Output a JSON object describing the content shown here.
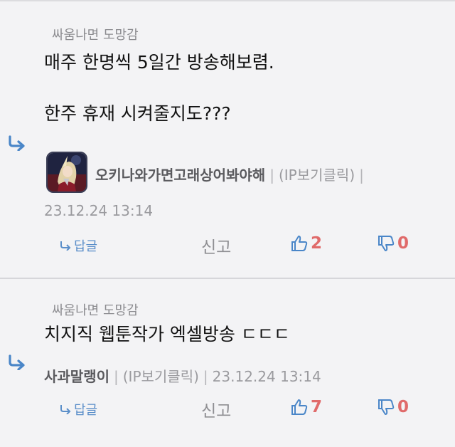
{
  "comments": [
    {
      "parent_name": "싸움나면 도망감",
      "text": "매주 한명씩 5일간 방송해보렴.\n\n한주 휴재 시켜줄지도???",
      "author": "오키나와가면고래상어봐야해",
      "ip_label": "(IP보기클릭)",
      "timestamp": "23.12.24 13:14",
      "reply_label": "답글",
      "report_label": "신고",
      "upvotes": "2",
      "downvotes": "0"
    },
    {
      "parent_name": "싸움나면 도망감",
      "text": "치지직 웹툰작가 엑셀방송 ㄷㄷㄷ",
      "author": "사과말랭이",
      "ip_label": "(IP보기클릭)",
      "timestamp": "23.12.24 13:14",
      "reply_label": "답글",
      "report_label": "신고",
      "upvotes": "7",
      "downvotes": "0"
    }
  ],
  "colors": {
    "accent": "#4a86c8",
    "vote_count": "#e06a6a",
    "background": "#f3f3f5"
  },
  "icons": [
    "reply-arrow-icon",
    "thumbs-up-icon",
    "thumbs-down-icon",
    "avatar"
  ]
}
